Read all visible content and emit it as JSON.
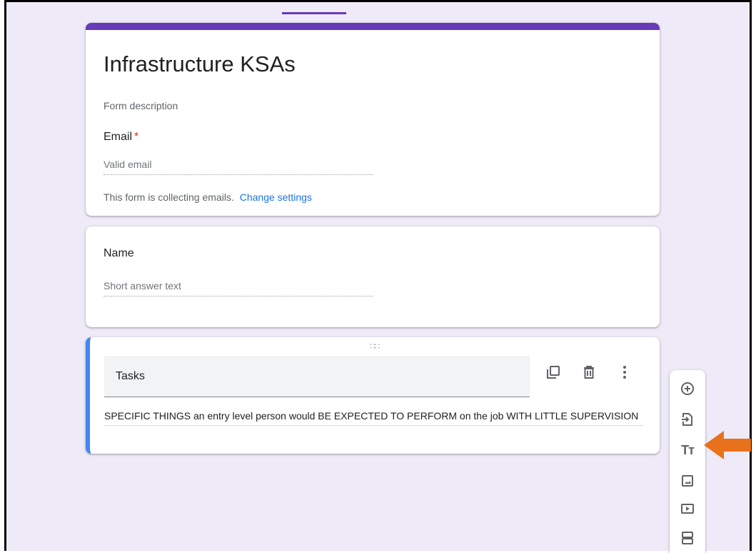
{
  "form": {
    "title": "Infrastructure KSAs",
    "description_placeholder": "Form description",
    "email": {
      "label": "Email",
      "required_mark": "*",
      "placeholder": "Valid email",
      "notice": "This form is collecting emails.",
      "link": "Change settings"
    }
  },
  "questions": [
    {
      "label": "Name",
      "answer_placeholder": "Short answer text"
    },
    {
      "title": "Tasks",
      "description": "SPECIFIC THINGS an entry level person would BE EXPECTED TO PERFORM on the job WITH LITTLE SUPERVISION",
      "actions": [
        "duplicate-icon",
        "delete-icon",
        "more-vert-icon"
      ]
    }
  ],
  "toolbar": {
    "items": [
      "add-question-icon",
      "import-questions-icon",
      "add-title-icon",
      "add-image-icon",
      "add-video-icon",
      "add-section-icon"
    ],
    "title_glyph": "Tт"
  },
  "colors": {
    "accent": "#673ab7",
    "active_border": "#4285f4",
    "arrow": "#e8711c",
    "background": "#efeaf7"
  }
}
